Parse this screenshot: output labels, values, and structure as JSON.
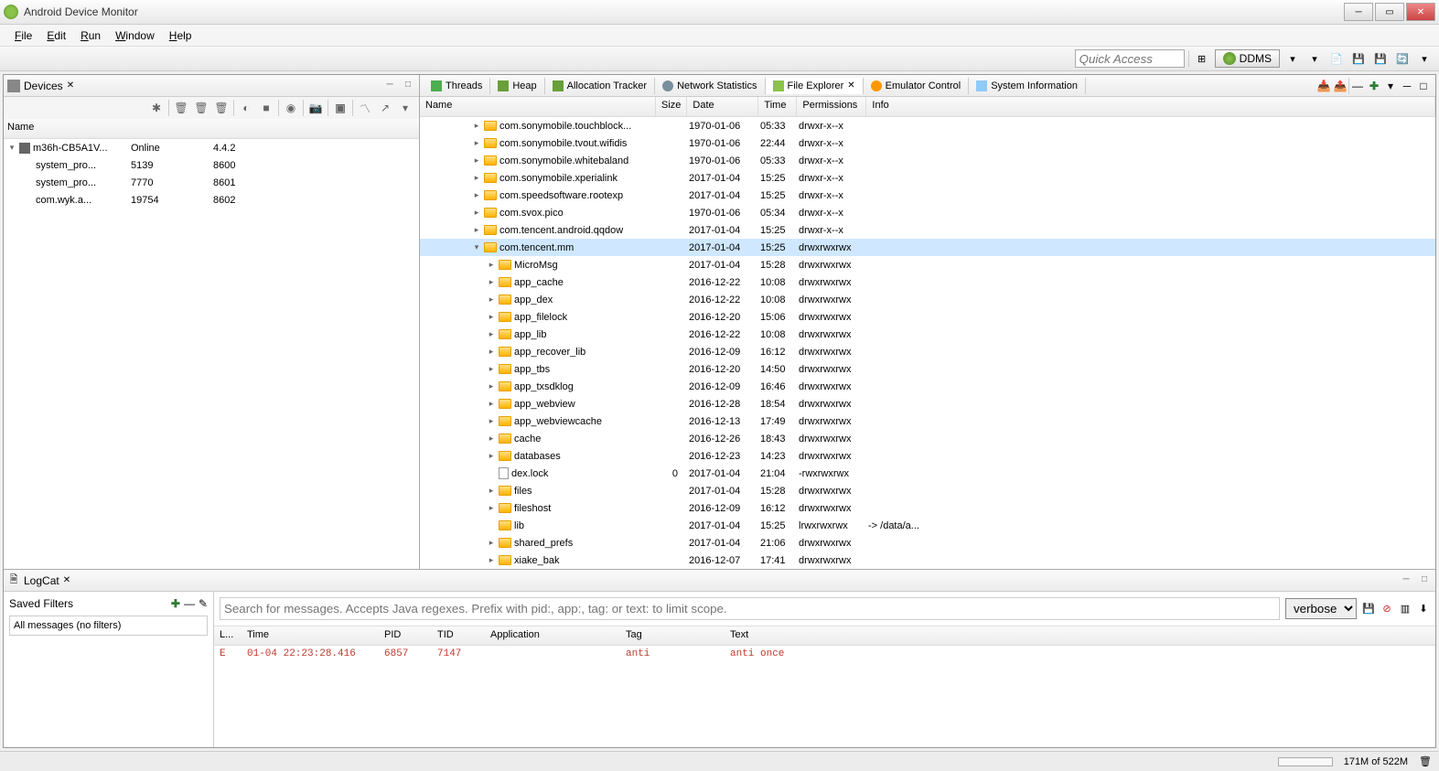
{
  "window": {
    "title": "Android Device Monitor"
  },
  "menu": [
    "File",
    "Edit",
    "Run",
    "Window",
    "Help"
  ],
  "toolbar": {
    "quick_access": "Quick Access",
    "perspective": "DDMS"
  },
  "devices": {
    "title": "Devices",
    "columns": [
      "Name",
      "",
      ""
    ],
    "rows": [
      {
        "level": 0,
        "expanded": true,
        "icon": "phone",
        "name": "m36h-CB5A1V...",
        "c1": "Online",
        "c2": "4.4.2"
      },
      {
        "level": 1,
        "name": "system_pro...",
        "c1": "5139",
        "c2": "8600"
      },
      {
        "level": 1,
        "name": "system_pro...",
        "c1": "7770",
        "c2": "8601"
      },
      {
        "level": 1,
        "name": "com.wyk.a...",
        "c1": "19754",
        "c2": "8602"
      }
    ]
  },
  "file_tabs": [
    {
      "icon": "fi-threads",
      "label": "Threads"
    },
    {
      "icon": "fi-heap",
      "label": "Heap"
    },
    {
      "icon": "fi-alloc",
      "label": "Allocation Tracker"
    },
    {
      "icon": "fi-net",
      "label": "Network Statistics"
    },
    {
      "icon": "fi-fe",
      "label": "File Explorer",
      "active": true
    },
    {
      "icon": "fi-emu",
      "label": "Emulator Control"
    },
    {
      "icon": "fi-sys",
      "label": "System Information"
    }
  ],
  "file_explorer": {
    "columns": [
      "Name",
      "Size",
      "Date",
      "Time",
      "Permissions",
      "Info"
    ],
    "rows": [
      {
        "level": 3,
        "icon": "folder",
        "name": "com.sonymobile.touchblock...",
        "size": "",
        "date": "1970-01-06",
        "time": "05:33",
        "perm": "drwxr-x--x",
        "info": ""
      },
      {
        "level": 3,
        "icon": "folder",
        "name": "com.sonymobile.tvout.wifidis",
        "size": "",
        "date": "1970-01-06",
        "time": "22:44",
        "perm": "drwxr-x--x",
        "info": ""
      },
      {
        "level": 3,
        "icon": "folder",
        "name": "com.sonymobile.whitebaland",
        "size": "",
        "date": "1970-01-06",
        "time": "05:33",
        "perm": "drwxr-x--x",
        "info": ""
      },
      {
        "level": 3,
        "icon": "folder",
        "name": "com.sonymobile.xperialink",
        "size": "",
        "date": "2017-01-04",
        "time": "15:25",
        "perm": "drwxr-x--x",
        "info": ""
      },
      {
        "level": 3,
        "icon": "folder",
        "name": "com.speedsoftware.rootexp",
        "size": "",
        "date": "2017-01-04",
        "time": "15:25",
        "perm": "drwxr-x--x",
        "info": ""
      },
      {
        "level": 3,
        "icon": "folder",
        "name": "com.svox.pico",
        "size": "",
        "date": "1970-01-06",
        "time": "05:34",
        "perm": "drwxr-x--x",
        "info": ""
      },
      {
        "level": 3,
        "icon": "folder",
        "name": "com.tencent.android.qqdow",
        "size": "",
        "date": "2017-01-04",
        "time": "15:25",
        "perm": "drwxr-x--x",
        "info": ""
      },
      {
        "level": 3,
        "icon": "folder",
        "name": "com.tencent.mm",
        "size": "",
        "date": "2017-01-04",
        "time": "15:25",
        "perm": "drwxrwxrwx",
        "info": "",
        "expanded": true,
        "selected": true
      },
      {
        "level": 4,
        "icon": "folder",
        "name": "MicroMsg",
        "size": "",
        "date": "2017-01-04",
        "time": "15:28",
        "perm": "drwxrwxrwx",
        "info": ""
      },
      {
        "level": 4,
        "icon": "folder",
        "name": "app_cache",
        "size": "",
        "date": "2016-12-22",
        "time": "10:08",
        "perm": "drwxrwxrwx",
        "info": ""
      },
      {
        "level": 4,
        "icon": "folder",
        "name": "app_dex",
        "size": "",
        "date": "2016-12-22",
        "time": "10:08",
        "perm": "drwxrwxrwx",
        "info": ""
      },
      {
        "level": 4,
        "icon": "folder",
        "name": "app_filelock",
        "size": "",
        "date": "2016-12-20",
        "time": "15:06",
        "perm": "drwxrwxrwx",
        "info": ""
      },
      {
        "level": 4,
        "icon": "folder",
        "name": "app_lib",
        "size": "",
        "date": "2016-12-22",
        "time": "10:08",
        "perm": "drwxrwxrwx",
        "info": ""
      },
      {
        "level": 4,
        "icon": "folder",
        "name": "app_recover_lib",
        "size": "",
        "date": "2016-12-09",
        "time": "16:12",
        "perm": "drwxrwxrwx",
        "info": ""
      },
      {
        "level": 4,
        "icon": "folder",
        "name": "app_tbs",
        "size": "",
        "date": "2016-12-20",
        "time": "14:50",
        "perm": "drwxrwxrwx",
        "info": ""
      },
      {
        "level": 4,
        "icon": "folder",
        "name": "app_txsdklog",
        "size": "",
        "date": "2016-12-09",
        "time": "16:46",
        "perm": "drwxrwxrwx",
        "info": ""
      },
      {
        "level": 4,
        "icon": "folder",
        "name": "app_webview",
        "size": "",
        "date": "2016-12-28",
        "time": "18:54",
        "perm": "drwxrwxrwx",
        "info": ""
      },
      {
        "level": 4,
        "icon": "folder",
        "name": "app_webviewcache",
        "size": "",
        "date": "2016-12-13",
        "time": "17:49",
        "perm": "drwxrwxrwx",
        "info": ""
      },
      {
        "level": 4,
        "icon": "folder",
        "name": "cache",
        "size": "",
        "date": "2016-12-26",
        "time": "18:43",
        "perm": "drwxrwxrwx",
        "info": ""
      },
      {
        "level": 4,
        "icon": "folder",
        "name": "databases",
        "size": "",
        "date": "2016-12-23",
        "time": "14:23",
        "perm": "drwxrwxrwx",
        "info": ""
      },
      {
        "level": 4,
        "icon": "file",
        "name": "dex.lock",
        "size": "0",
        "date": "2017-01-04",
        "time": "21:04",
        "perm": "-rwxrwxrwx",
        "info": "",
        "noexp": true
      },
      {
        "level": 4,
        "icon": "folder",
        "name": "files",
        "size": "",
        "date": "2017-01-04",
        "time": "15:28",
        "perm": "drwxrwxrwx",
        "info": ""
      },
      {
        "level": 4,
        "icon": "folder",
        "name": "fileshost",
        "size": "",
        "date": "2016-12-09",
        "time": "16:12",
        "perm": "drwxrwxrwx",
        "info": ""
      },
      {
        "level": 4,
        "icon": "folder",
        "name": "lib",
        "size": "",
        "date": "2017-01-04",
        "time": "15:25",
        "perm": "lrwxrwxrwx",
        "info": "-> /data/a...",
        "noexp": true
      },
      {
        "level": 4,
        "icon": "folder",
        "name": "shared_prefs",
        "size": "",
        "date": "2017-01-04",
        "time": "21:06",
        "perm": "drwxrwxrwx",
        "info": ""
      },
      {
        "level": 4,
        "icon": "folder",
        "name": "xiake_bak",
        "size": "",
        "date": "2016-12-07",
        "time": "17:41",
        "perm": "drwxrwxrwx",
        "info": ""
      }
    ]
  },
  "logcat": {
    "title": "LogCat",
    "filters_title": "Saved Filters",
    "filters_item": "All messages (no filters)",
    "search_placeholder": "Search for messages. Accepts Java regexes. Prefix with pid:, app:, tag: or text: to limit scope.",
    "verbose": "verbose",
    "columns": [
      "L...",
      "Time",
      "PID",
      "TID",
      "Application",
      "Tag",
      "Text"
    ],
    "rows": [
      {
        "level": "E",
        "time": "01-04 22:23:28.416",
        "pid": "6857",
        "tid": "7147",
        "app": "",
        "tag": "anti",
        "text": "anti once",
        "cls": "err"
      }
    ]
  },
  "status": {
    "mem": "171M of 522M"
  }
}
